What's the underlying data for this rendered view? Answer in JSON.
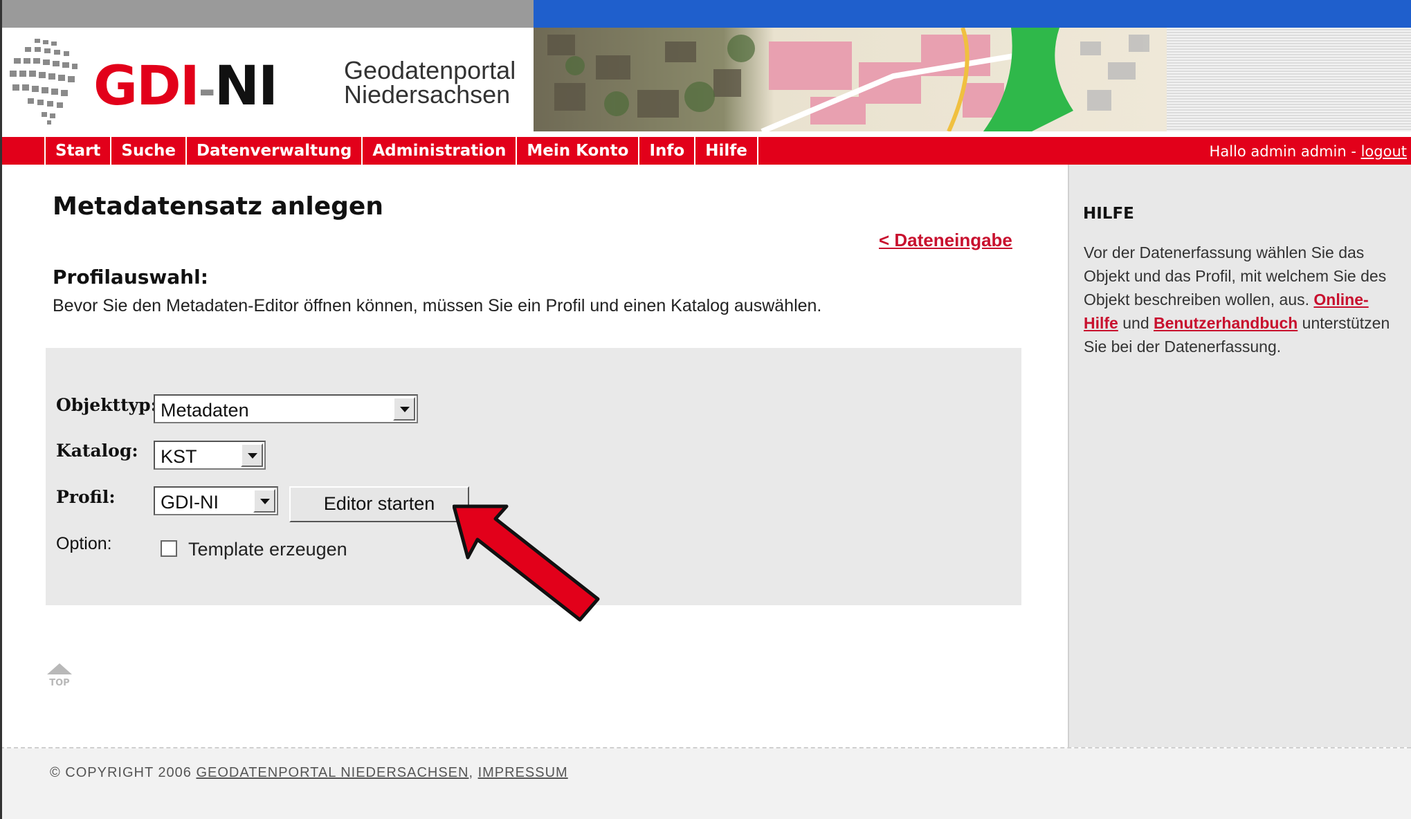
{
  "header": {
    "logo_text_gdi": "GDI",
    "logo_text_ni": "NI",
    "portal_line1": "Geodatenportal",
    "portal_line2": "Niedersachsen"
  },
  "nav": {
    "items": [
      {
        "label": "Start"
      },
      {
        "label": "Suche"
      },
      {
        "label": "Datenverwaltung"
      },
      {
        "label": "Administration"
      },
      {
        "label": "Mein Konto"
      },
      {
        "label": "Info"
      },
      {
        "label": "Hilfe"
      }
    ],
    "greeting": "Hallo admin admin - ",
    "logout": "logout"
  },
  "main": {
    "title": "Metadatensatz anlegen",
    "back_link": "< Dateneingabe",
    "section_title": "Profilauswahl:",
    "intro": "Bevor Sie den Metadaten-Editor öffnen können, müssen Sie ein Profil und einen Katalog auswählen.",
    "form": {
      "objekttyp_label": "Objekttyp:",
      "objekttyp_value": "Metadaten",
      "katalog_label": "Katalog:",
      "katalog_value": "KST",
      "profil_label": "Profil:",
      "profil_value": "GDI-NI",
      "editor_button": "Editor starten",
      "option_label": "Option:",
      "template_label": "Template erzeugen",
      "template_checked": false
    },
    "top_label": "TOP"
  },
  "help": {
    "title": "HILFE",
    "text_part1": "Vor der Datenerfassung wählen Sie das Objekt und das Profil, mit welchem Sie des Objekt beschreiben wollen, aus. ",
    "link_online_help": "Online-Hilfe",
    "text_und": " und ",
    "link_manual": "Benutzerhandbuch",
    "text_part2": " unterstützen Sie bei der Datenerfassung."
  },
  "footer": {
    "copyright_symbol": "©",
    "copyright": " COPYRIGHT 2006 ",
    "portal_link": "GEODATENPORTAL NIEDERSACHSEN",
    "separator": ", ",
    "impressum": "IMPRESSUM"
  },
  "colors": {
    "brand_red": "#e2001a",
    "link_red": "#c8102e",
    "top_blue": "#1f5fcc"
  }
}
